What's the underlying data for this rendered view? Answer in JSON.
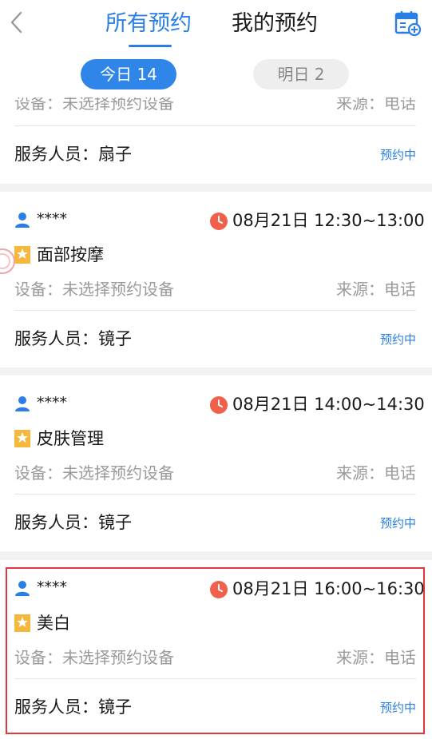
{
  "header": {
    "back_icon": "chevron-left-icon",
    "tabs": [
      {
        "label": "所有预约",
        "active": true
      },
      {
        "label": "我的预约",
        "active": false
      }
    ],
    "calendar_icon": "calendar-add-icon",
    "accent_color": "#2a7fe6"
  },
  "day_filter": {
    "today": "今日 14",
    "tomorrow": "明日 2"
  },
  "partial_card": {
    "device": "设备：未选择预约设备",
    "source": "来源：电话",
    "staff": "服务人员：扇子",
    "status": "预约中"
  },
  "appointments": [
    {
      "customer": "****",
      "time": "08月21日 12:30~13:00",
      "service": "面部按摩",
      "device": "设备：未选择预约设备",
      "source": "来源：电话",
      "staff": "服务人员：镜子",
      "status": "预约中"
    },
    {
      "customer": "****",
      "time": "08月21日 14:00~14:30",
      "service": "皮肤管理",
      "device": "设备：未选择预约设备",
      "source": "来源：电话",
      "staff": "服务人员：镜子",
      "status": "预约中"
    },
    {
      "customer": "****",
      "time": "08月21日 16:00~16:30",
      "service": "美白",
      "device": "设备：未选择预约设备",
      "source": "来源：电话",
      "staff": "服务人员：镜子",
      "status": "预约中"
    }
  ]
}
